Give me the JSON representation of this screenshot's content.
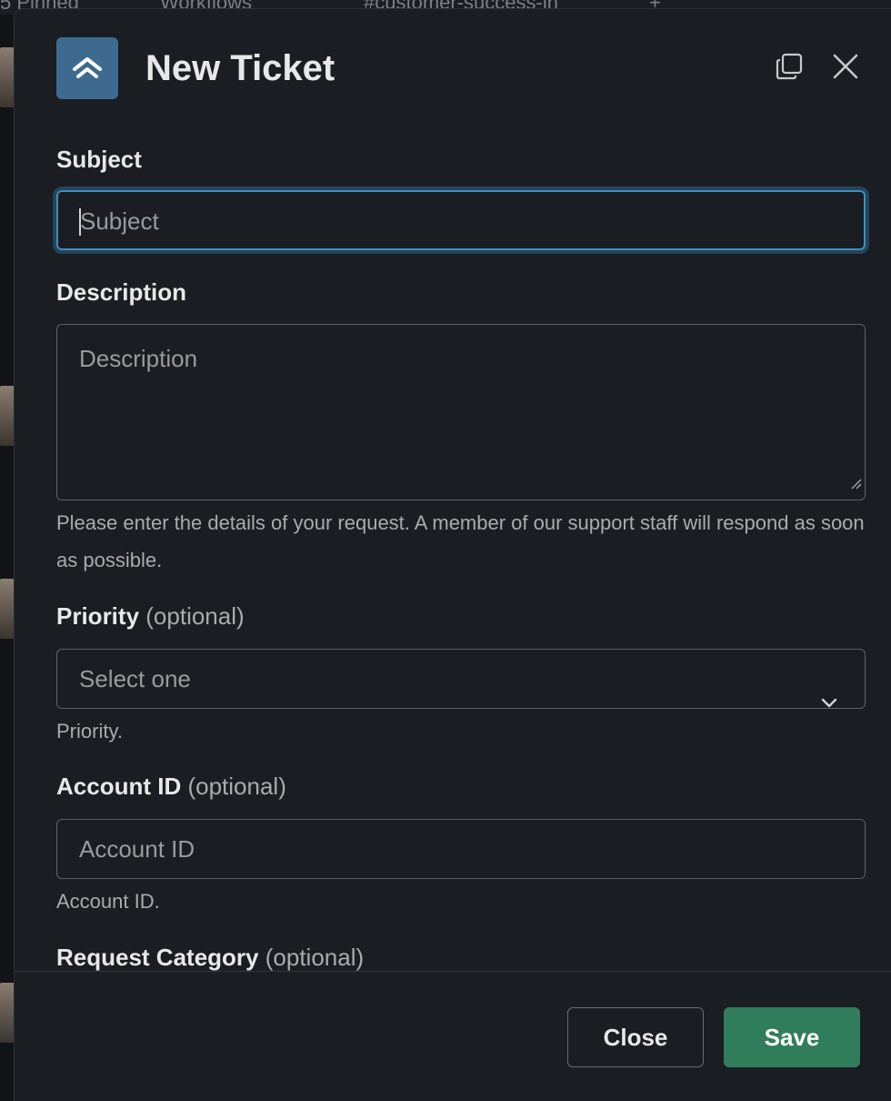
{
  "background": {
    "tabs": [
      "5 Pinned",
      "Workflows",
      "#customer-success-in",
      "+"
    ]
  },
  "modal": {
    "title": "New Ticket",
    "icons": {
      "app_logo": "app-logo-icon",
      "expand": "expand-icon",
      "close": "close-icon"
    }
  },
  "form": {
    "subject": {
      "label": "Subject",
      "placeholder": "Subject",
      "value": ""
    },
    "description": {
      "label": "Description",
      "placeholder": "Description",
      "hint": "Please enter the details of your request. A member of our support staff will respond as soon as possible."
    },
    "priority": {
      "label": "Priority",
      "optional": "(optional)",
      "selected": "Select one",
      "hint": "Priority."
    },
    "account_id": {
      "label": "Account ID",
      "optional": "(optional)",
      "placeholder": "Account ID",
      "hint": "Account ID."
    },
    "request_category": {
      "label": "Request Category",
      "optional": "(optional)"
    }
  },
  "footer": {
    "close_label": "Close",
    "save_label": "Save"
  },
  "colors": {
    "accent_focus": "#3c8ec4",
    "save_button": "#2f7d5b",
    "logo_bg": "#3e6a8f"
  }
}
